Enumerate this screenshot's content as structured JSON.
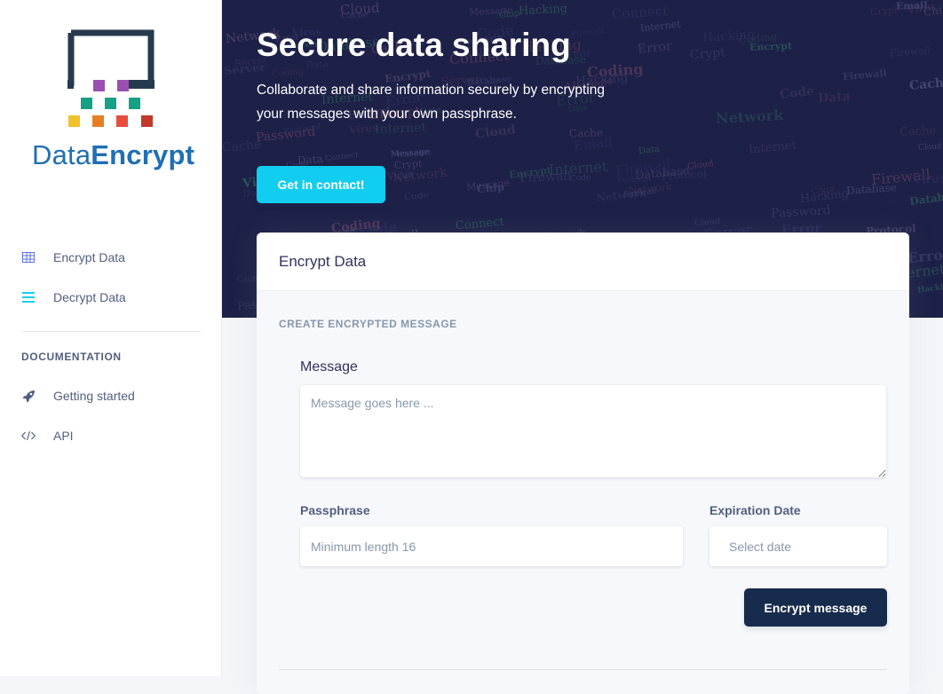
{
  "brand": {
    "name_light": "Data",
    "name_bold": "Encrypt"
  },
  "sidebar": {
    "items": [
      {
        "label": "Encrypt Data",
        "icon": "grid-table-icon"
      },
      {
        "label": "Decrypt Data",
        "icon": "list-icon"
      }
    ],
    "section_heading": "DOCUMENTATION",
    "doc_items": [
      {
        "label": "Getting started",
        "icon": "rocket-icon"
      },
      {
        "label": "API",
        "icon": "code-icon"
      }
    ]
  },
  "hero": {
    "title": "Secure data sharing",
    "subtitle": "Collaborate and share information securely by encrypting your messages with your own passphrase.",
    "cta": "Get in contact!",
    "background_words": [
      "Code",
      "Database",
      "Hacking",
      "Server",
      "Firewall",
      "Virus",
      "Cloud",
      "Crypt",
      "Password",
      "Email",
      "Encrypt",
      "Message",
      "Internet",
      "Chip",
      "Data",
      "Coding",
      "Cache",
      "Connect",
      "Error",
      "Protocol",
      "Network"
    ]
  },
  "card": {
    "title": "Encrypt Data",
    "subtitle": "CREATE ENCRYPTED MESSAGE",
    "message_label": "Message",
    "message_placeholder": "Message goes here ...",
    "passphrase_label": "Passphrase",
    "passphrase_placeholder": "Minimum length 16",
    "expiration_label": "Expiration Date",
    "expiration_placeholder": "Select date",
    "submit": "Encrypt message"
  },
  "colors": {
    "brand_blue": "#1f6fb3",
    "hero_bg": "#1d2047",
    "cta": "#11cdef",
    "primary_dark": "#172b4d",
    "nav_icon_blue": "#5e72e4",
    "nav_icon_cyan": "#11cdef"
  }
}
